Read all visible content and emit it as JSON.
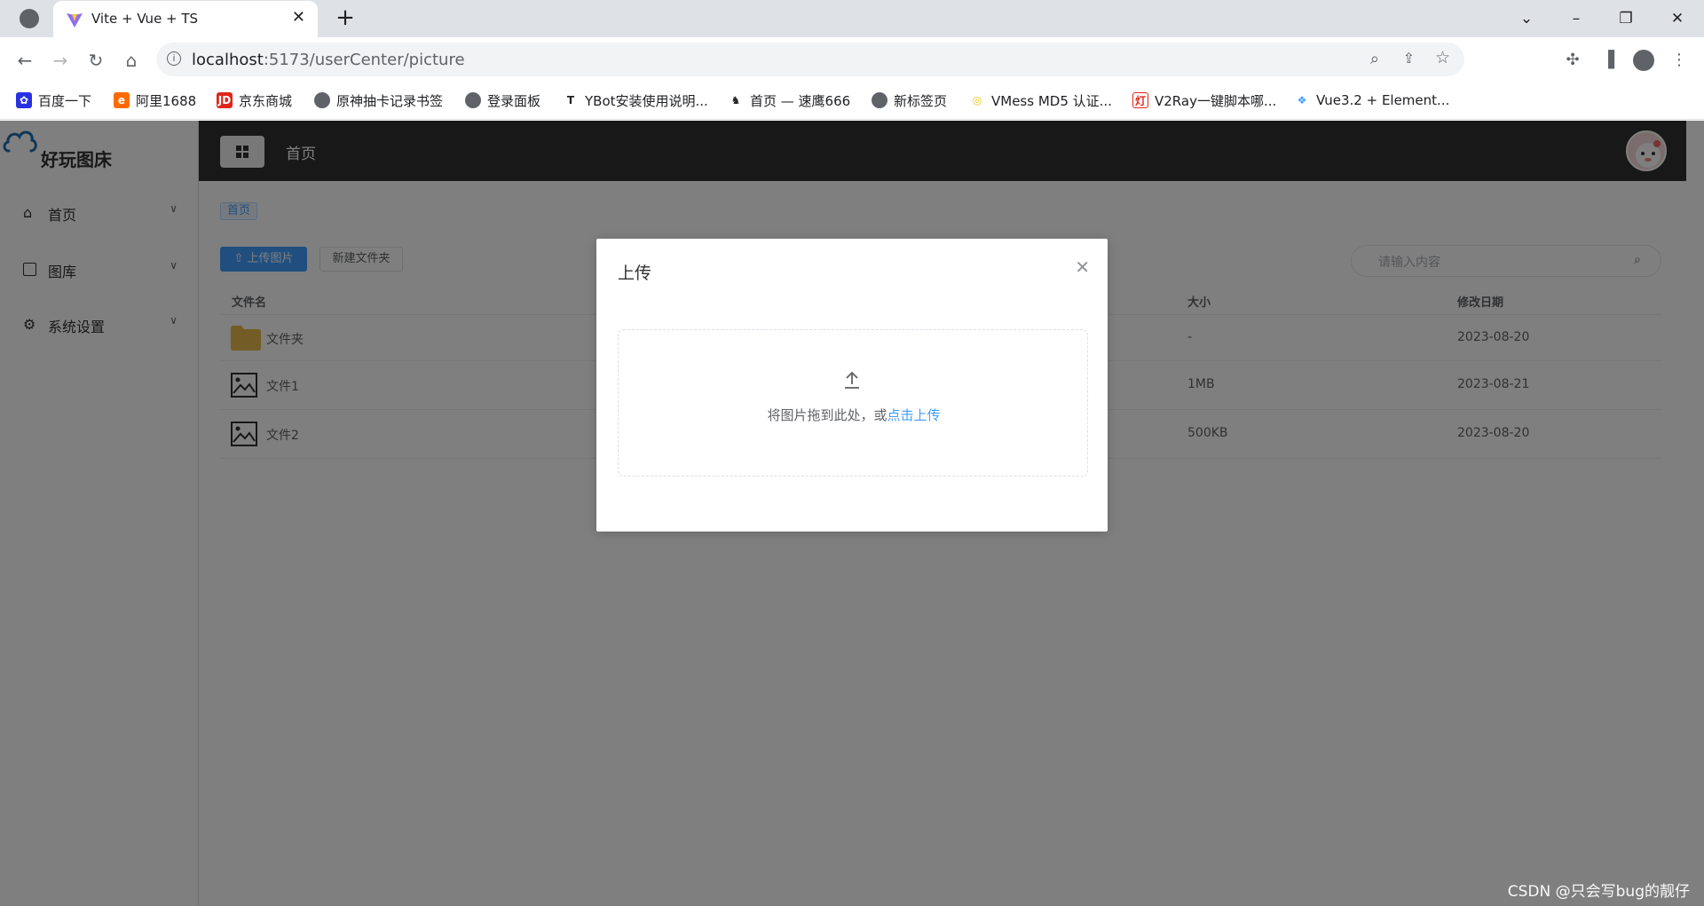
{
  "browser": {
    "tab_title": "Vite + Vue + TS",
    "url_host": "localhost",
    "url_path": ":5173/userCenter/picture",
    "bookmarks": [
      {
        "label": "百度一下",
        "icon": "baidu-icon",
        "color": "#2932e1"
      },
      {
        "label": "阿里1688",
        "icon": "alibaba-icon",
        "color": "#ff6a00"
      },
      {
        "label": "京东商城",
        "icon": "jd-icon",
        "color": "#e1251b"
      },
      {
        "label": "原神抽卡记录书签",
        "icon": "globe-icon",
        "color": "#5f6368"
      },
      {
        "label": "登录面板",
        "icon": "globe-icon",
        "color": "#5f6368"
      },
      {
        "label": "YBot安装使用说明...",
        "icon": "t-icon",
        "color": "#202124"
      },
      {
        "label": "首页 — 速鹰666",
        "icon": "eagle-icon",
        "color": "#202124"
      },
      {
        "label": "新标签页",
        "icon": "globe-icon",
        "color": "#5f6368"
      },
      {
        "label": "VMess MD5 认证...",
        "icon": "vmess-icon",
        "color": "#f5c400"
      },
      {
        "label": "V2Ray一键脚本哪...",
        "icon": "v2ray-icon",
        "color": "#e1251b"
      },
      {
        "label": "Vue3.2 + Element...",
        "icon": "element-icon",
        "color": "#409eff"
      }
    ]
  },
  "sidebar": {
    "logo_text": "好玩图床",
    "items": [
      {
        "label": "首页",
        "icon": "home-icon"
      },
      {
        "label": "图库",
        "icon": "picture-icon"
      },
      {
        "label": "系统设置",
        "icon": "gear-icon"
      }
    ]
  },
  "header": {
    "title": "首页"
  },
  "main": {
    "breadcrumb": "首页",
    "upload_button": "上传图片",
    "new_folder_button": "新建文件夹",
    "search_placeholder": "请输入内容",
    "columns": [
      "文件名",
      "大小",
      "修改日期"
    ],
    "rows": [
      {
        "name": "文件夹",
        "size": "-",
        "date": "2023-08-20",
        "icon": "folder-icon"
      },
      {
        "name": "文件1",
        "size": "1MB",
        "date": "2023-08-21",
        "icon": "image-icon"
      },
      {
        "name": "文件2",
        "size": "500KB",
        "date": "2023-08-20",
        "icon": "image-icon"
      }
    ]
  },
  "dialog": {
    "title": "上传",
    "drop_text": "将图片拖到此处，或",
    "drop_link": "点击上传"
  },
  "watermark": "CSDN @只会写bug的靓仔",
  "colors": {
    "primary": "#409eff",
    "header_bg": "#303133",
    "mask": "rgba(0,0,0,0.5)"
  }
}
